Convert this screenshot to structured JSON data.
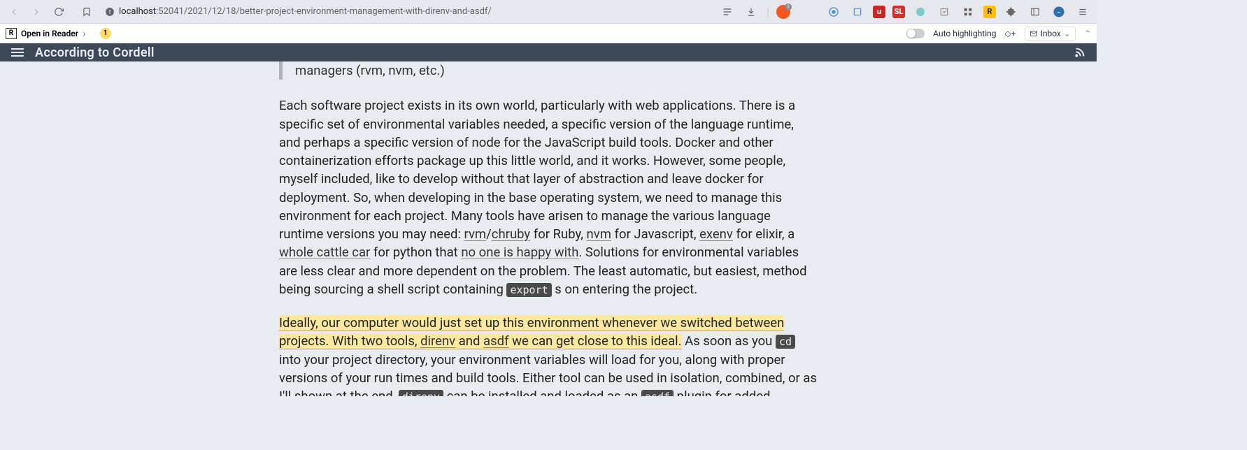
{
  "browser": {
    "url_host": "localhost",
    "url_port_path": ":52041/2021/12/18/better-project-environment-management-with-direnv-and-asdf/",
    "brave_count": "3"
  },
  "reader": {
    "open": "Open in Reader",
    "count": "1",
    "auto_hl": "Auto highlighting",
    "inbox": "Inbox"
  },
  "site": {
    "title": "According to Cordell"
  },
  "article": {
    "quote_tail": "managers (rvm, nvm, etc.)",
    "p1_a": "Each software project exists in its own world, particularly with web applications. There is a specific set of environmental variables needed, a specific version of the language runtime, and perhaps a specific version of node for the JavaScript build tools. Docker and other containerization efforts package up this little world, and it works. However, some people, myself included, like to develop without that layer of abstraction and leave docker for deployment. So, when developing in the base operating system, we need to manage this environment for each project. Many tools have arisen to manage the various language runtime versions you may need: ",
    "link_rvm": "rvm",
    "slash": "/",
    "link_chruby": "chruby",
    "p1_b": " for Ruby, ",
    "link_nvm": "nvm",
    "p1_c": " for Javascript, ",
    "link_exenv": "exenv",
    "p1_d": " for elixir, a ",
    "link_cattle": "whole cattle car",
    "p1_e": " for python that ",
    "link_noone": "no one is happy with",
    "p1_f": ". Solutions for environmental variables are less clear and more dependent on the problem. The least automatic, but easiest, method being sourcing a shell script containing ",
    "code_export": "export",
    "p1_g": " s on entering the project.",
    "hl_a": "Ideally, our computer would just set up this environment whenever we switched between projects. With two tools, ",
    "hl_direnv": "direnv",
    "hl_b": " and ",
    "hl_asdf": "asdf",
    "hl_c": " we can get close to this ideal.",
    "p2_a": " As soon as you ",
    "code_cd": "cd",
    "p2_b": " into your project directory, your environment variables will load for you, along with proper versions of your run times and build tools. Either tool can be used in isolation, combined, or as I'll shown at the end, ",
    "code_direnv": "direnv",
    "p2_c": " can be installed and loaded as an ",
    "code_asdf": "asdf",
    "p2_d": " plugin for added benefits. Let's see the two in action first:"
  }
}
